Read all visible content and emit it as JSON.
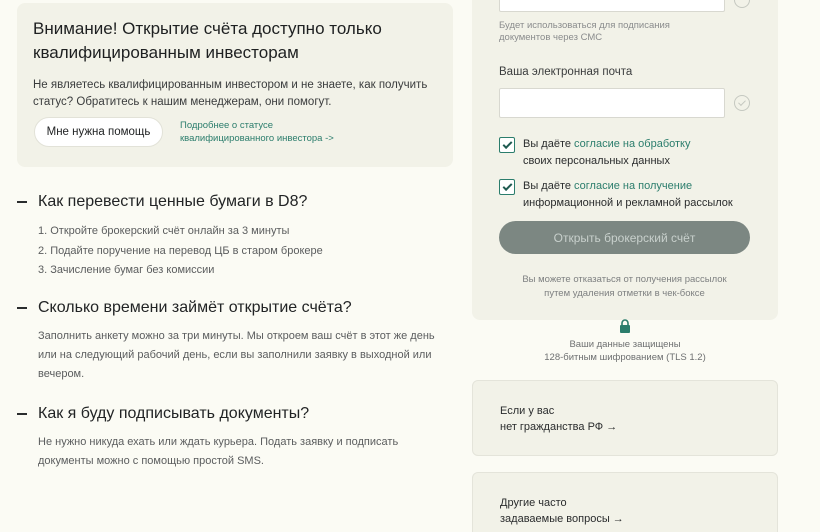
{
  "notice": {
    "title_line1": "Внимание! Открытие счёта доступно только",
    "title_line2": "квалифицированным инвесторам",
    "text_line1": "Не являетесь квалифицированным инвестором и не знаете, как получить",
    "text_line2": "статус? Обратитесь к нашим менеджерам, они помогут.",
    "help_button": "Мне нужна помощь",
    "status_link_line1": "Подробнее о статусе",
    "status_link_line2": "квалифицированного инвестора ->"
  },
  "faq": [
    {
      "question": "Как перевести ценные бумаги в D8?",
      "steps": [
        "1. Откройте брокерский счёт онлайн за 3 минуты",
        "2. Подайте поручение на перевод ЦБ в старом брокере",
        "3. Зачисление бумаг без комиссии"
      ]
    },
    {
      "question": "Сколько времени займёт открытие счёта?",
      "answer_lines": [
        "Заполнить анкету можно за три минуты. Мы откроем ваш счёт в этот же день",
        "или на следующий рабочий день, если вы заполнили заявку в выходной или",
        "вечером."
      ]
    },
    {
      "question": "Как я буду подписывать документы?",
      "answer_lines": [
        "Не нужно никуда ехать или ждать курьера. Подать заявку и подписать",
        "документы можно с помощью простой SMS."
      ]
    }
  ],
  "form": {
    "phone_hint_line1": "Будет использоваться для подписания",
    "phone_hint_line2": "документов через СМС",
    "email_label": "Ваша электронная почта",
    "email_value": "",
    "consent1_prefix": "Вы даёте ",
    "consent1_link": "согласие на обработку",
    "consent1_rest": "своих персональных данных",
    "consent2_prefix": "Вы даёте ",
    "consent2_link": "согласие на получение",
    "consent2_rest": "информационной и рекламной рассылок",
    "open_button": "Открыть брокерский счёт",
    "unsub_line1": "Вы можете отказаться от получения рассылок",
    "unsub_line2": "путем удаления отметки в чек-боксе"
  },
  "security": {
    "line1": "Ваши данные защищены",
    "line2": "128-битным шифрованием (TLS 1.2)"
  },
  "cards": [
    {
      "line1": "Если у вас",
      "line2": "нет гражданства РФ →"
    },
    {
      "line1": "Другие часто",
      "line2": "задаваемые вопросы →"
    }
  ],
  "colors": {
    "accent": "#2b7d6c",
    "panel": "#f2f2e8",
    "button_disabled": "#7c8782"
  }
}
